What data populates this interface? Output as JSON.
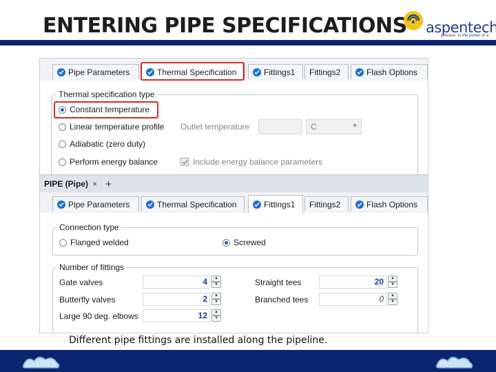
{
  "slide": {
    "title": "ENTERING PIPE SPECIFICATIONS",
    "caption": "Different pipe fittings are installed along the pipeline.",
    "logo_text": "aspentech",
    "logo_tagline": "process. to the power of a"
  },
  "colors": {
    "accent_blue": "#0b2470",
    "highlight_red": "#d42a2a",
    "check_blue": "#1f6fd1"
  },
  "top_tabs": [
    {
      "label": "Pipe Parameters",
      "icon": "check-circle-icon"
    },
    {
      "label": "Thermal Specification",
      "icon": "check-circle-icon",
      "active": true
    },
    {
      "label": "Fittings1",
      "icon": "check-circle-icon"
    },
    {
      "label": "Fittings2"
    },
    {
      "label": "Flash Options",
      "icon": "check-circle-icon"
    }
  ],
  "thermal": {
    "group_title": "Thermal specification type",
    "options": [
      {
        "label": "Constant temperature",
        "selected": true
      },
      {
        "label": "Linear temperature profile",
        "selected": false
      },
      {
        "label": "Adiabatic (zero duty)",
        "selected": false
      },
      {
        "label": "Perform energy balance",
        "selected": false
      }
    ],
    "outlet_label": "Outlet temperature",
    "outlet_unit": "C",
    "include_energy_label": "Include energy balance parameters",
    "include_energy_checked": true
  },
  "doc_tab": {
    "label": "PIPE (Pipe)",
    "close": "×",
    "add": "+"
  },
  "bottom_tabs": [
    {
      "label": "Pipe Parameters",
      "icon": "check-circle-icon"
    },
    {
      "label": "Thermal Specification",
      "icon": "check-circle-icon"
    },
    {
      "label": "Fittings1",
      "icon": "check-circle-icon",
      "active": true
    },
    {
      "label": "Fittings2"
    },
    {
      "label": "Flash Options",
      "icon": "check-circle-icon"
    }
  ],
  "connection": {
    "group_title": "Connection type",
    "options": [
      {
        "label": "Flanged welded",
        "selected": false
      },
      {
        "label": "Screwed",
        "selected": true
      }
    ]
  },
  "fittings": {
    "group_title": "Number of fittings",
    "left": [
      {
        "label": "Gate valves",
        "value": "4"
      },
      {
        "label": "Butterfly valves",
        "value": "2"
      },
      {
        "label": "Large 90 deg. elbows",
        "value": "12"
      }
    ],
    "right": [
      {
        "label": "Straight tees",
        "value": "20"
      },
      {
        "label": "Branched tees",
        "value": "0"
      }
    ]
  }
}
